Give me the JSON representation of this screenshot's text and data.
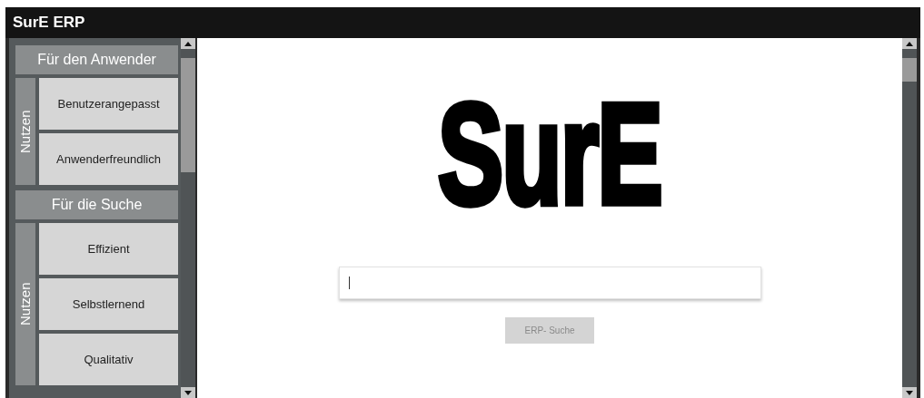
{
  "window": {
    "title": "SurE ERP"
  },
  "sidebar": {
    "groups": [
      {
        "title": "Für den Anwender",
        "label": "Nutzen",
        "items": [
          "Benutzerangepasst",
          "Anwenderfreundlich"
        ]
      },
      {
        "title": "Für die Suche",
        "label": "Nutzen",
        "items": [
          "Effizient",
          "Selbstlernend",
          "Qualitativ"
        ]
      }
    ]
  },
  "main": {
    "logo": "SurE",
    "button": "ERP- Suche"
  }
}
